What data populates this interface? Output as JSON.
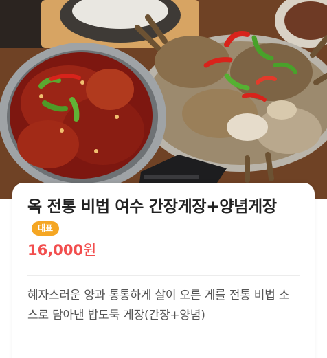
{
  "product": {
    "photo_alt": "food-photo",
    "title": "옥 전통 비법 여수 간장게장+양념게장",
    "badge": "대표",
    "price_amount": "16,000",
    "price_unit": "원",
    "description": "혜자스러운 양과 통통하게 살이 오른 게를 전통 비법 소스로 담아낸 밥도둑 게장(간장+양념)"
  },
  "colors": {
    "price": "#f24e4e",
    "badge": "#f5a623",
    "title": "#222222",
    "description": "#555555"
  }
}
